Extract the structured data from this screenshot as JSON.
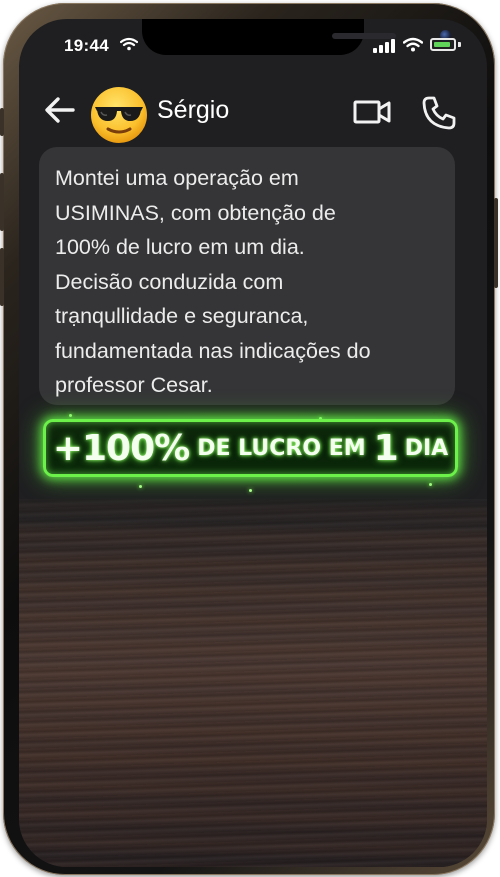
{
  "status_bar": {
    "time": "19:44"
  },
  "header": {
    "contact_name": "Sérgio",
    "avatar_icon": "sunglasses-emoji-icon",
    "back_icon": "arrow-left-icon",
    "video_icon": "video-camera-icon",
    "call_icon": "phone-icon"
  },
  "message": {
    "text": "Montei uma operação em\nUSIMINAS, com obtenção de\n100% de lucro em um dia.\nDecisão conduzida com\ntrạnqullidade e seguranca,\nfundamentada nas indicações do\nprofessor Cesar."
  },
  "banner": {
    "big": "+100%",
    "small": "DE LUCRO EM",
    "number": "1",
    "last": "DIA"
  },
  "colors": {
    "banner_border": "#6cf04a",
    "bubble_bg": "#353537",
    "screen_bg": "#1f1f21"
  }
}
